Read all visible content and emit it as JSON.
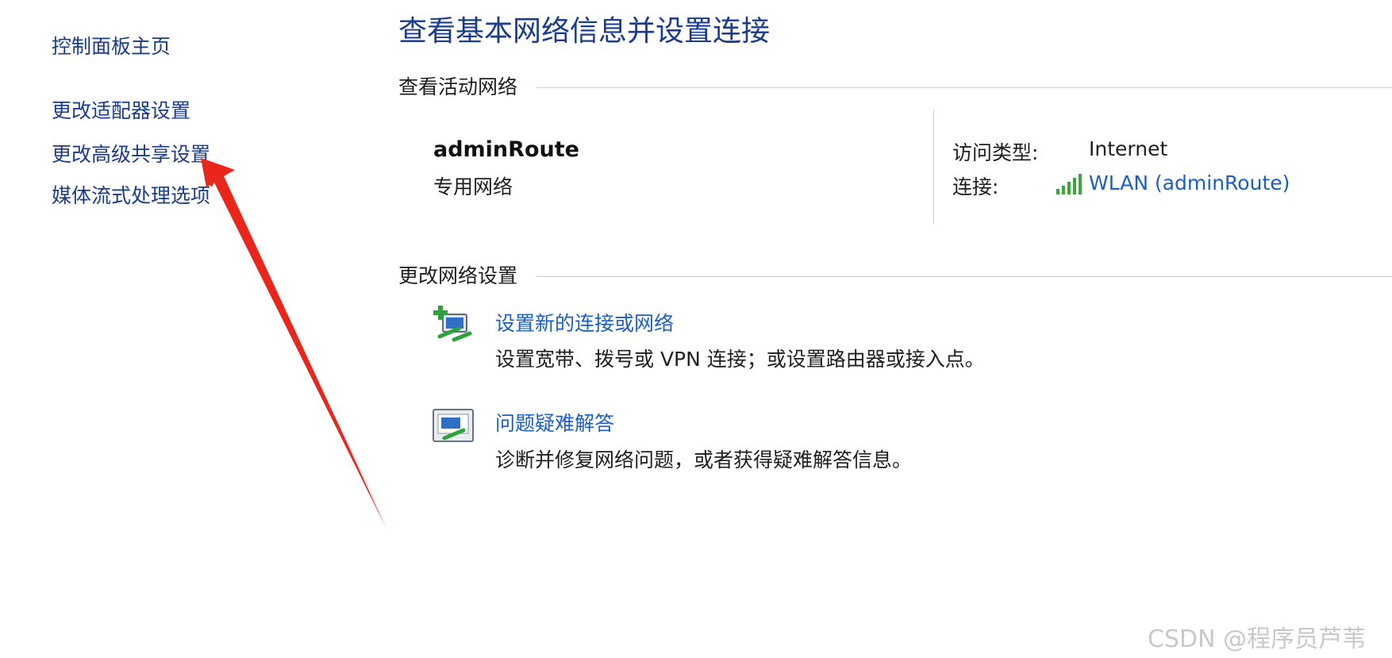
{
  "sidebar": {
    "home": "控制面板主页",
    "items": [
      {
        "label": "更改适配器设置"
      },
      {
        "label": "更改高级共享设置"
      },
      {
        "label": "媒体流式处理选项"
      }
    ]
  },
  "page": {
    "title": "查看基本网络信息并设置连接"
  },
  "active_networks": {
    "heading": "查看活动网络",
    "network_name": "adminRoute",
    "network_type": "专用网络",
    "access_type_label": "访问类型:",
    "access_type_value": "Internet",
    "connections_label": "连接:",
    "connection_link": "WLAN (adminRoute)",
    "connection_icon": "wifi-signal-icon"
  },
  "change_settings": {
    "heading": "更改网络设置",
    "tasks": [
      {
        "icon": "new-connection-icon",
        "link": "设置新的连接或网络",
        "description": "设置宽带、拨号或 VPN 连接；或设置路由器或接入点。"
      },
      {
        "icon": "troubleshoot-icon",
        "link": "问题疑难解答",
        "description": "诊断并修复网络问题，或者获得疑难解答信息。"
      }
    ]
  },
  "watermark": "CSDN @程序员芦苇",
  "colors": {
    "link": "#1a5fc8",
    "nav": "#1a3c8c",
    "annotation_arrow": "#e8261c"
  }
}
